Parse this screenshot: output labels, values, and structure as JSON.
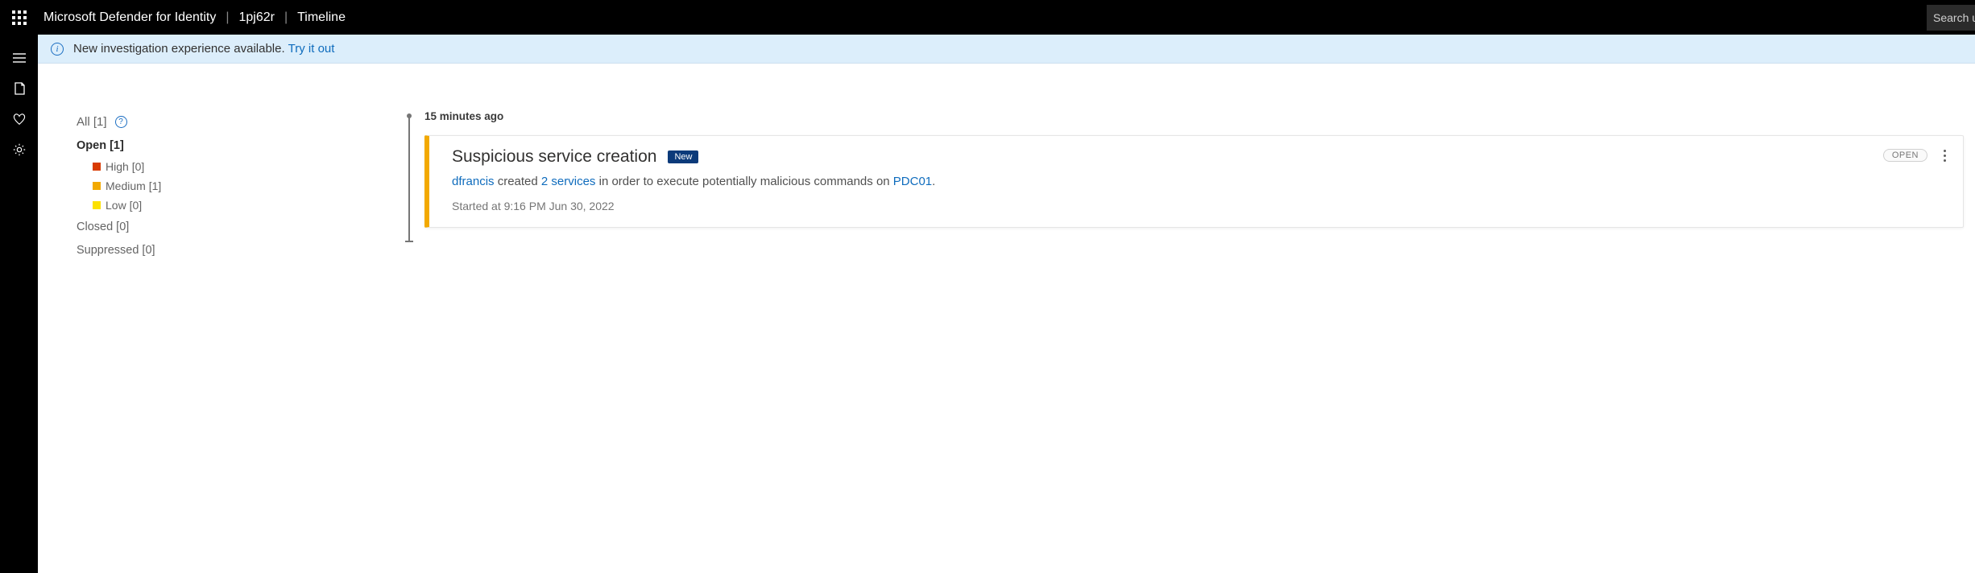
{
  "header": {
    "product": "Microsoft Defender for Identity",
    "workspace": "1pj62r",
    "section": "Timeline",
    "search_placeholder": "Search users,"
  },
  "banner": {
    "text": "New investigation experience available.",
    "link_label": "Try it out"
  },
  "filters": {
    "all": {
      "label": "All",
      "count": "[1]"
    },
    "open": {
      "label": "Open",
      "count": "[1]"
    },
    "high": {
      "label": "High",
      "count": "[0]"
    },
    "medium": {
      "label": "Medium",
      "count": "[1]"
    },
    "low": {
      "label": "Low",
      "count": "[0]"
    },
    "closed": {
      "label": "Closed",
      "count": "[0]"
    },
    "suppressed": {
      "label": "Suppressed",
      "count": "[0]"
    }
  },
  "colors": {
    "severity_bar": "#f2a900",
    "link": "#0f6cbd",
    "banner_bg": "#dceefb"
  },
  "timeline": {
    "timestamp_rel": "15 minutes ago",
    "alert": {
      "title": "Suspicious service creation",
      "new_badge": "New",
      "status": "OPEN",
      "actor": "dfrancis",
      "verb": " created ",
      "object": "2 services",
      "mid": " in order to execute potentially malicious commands on ",
      "target": "PDC01",
      "tail": ".",
      "started_at": "Started at 9:16 PM Jun 30, 2022"
    }
  }
}
